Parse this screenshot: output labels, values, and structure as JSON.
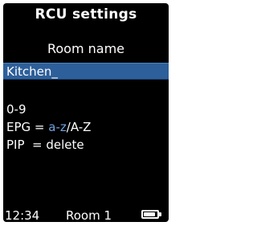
{
  "screen": {
    "title": "RCU settings",
    "field_label": "Room name",
    "input_value": "Kitchen_"
  },
  "hints": {
    "digits": "0-9",
    "epg_label": "EPG = ",
    "epg_lower": "a-z",
    "epg_sep": "/",
    "epg_upper": "A-Z",
    "pip": "PIP  = delete"
  },
  "status": {
    "time": "12:34",
    "room": "Room 1",
    "battery_level": 0.85
  },
  "colors": {
    "background": "#000000",
    "selection": "#2d5f9a",
    "highlight_text": "#6fa4e0",
    "text": "#ffffff"
  },
  "icons": {
    "battery": "battery-icon"
  }
}
